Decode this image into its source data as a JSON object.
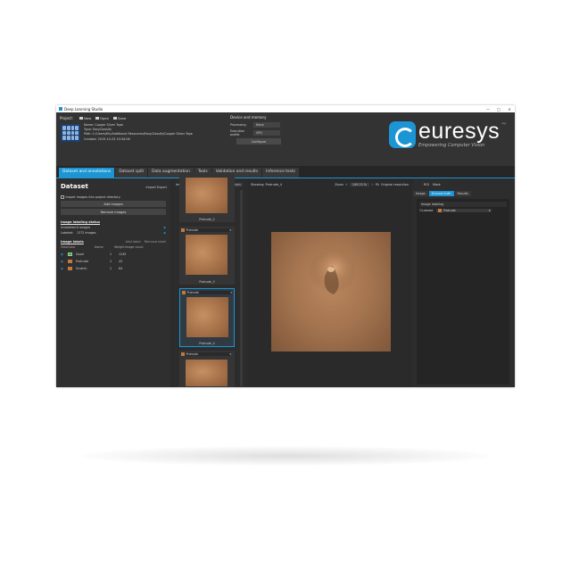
{
  "window": {
    "title": "Deep Learning Studio",
    "controls": [
      "—",
      "□",
      "✕"
    ]
  },
  "project": {
    "label": "Project:",
    "new_label": "New",
    "open_label": "Open",
    "save_label": "Save",
    "name": "Name: Copper Silver Tape",
    "type": "Type: EasyClassify",
    "path": "Path: C:/Users/Etc/Additional Resources/EasyClassify/Copper Silver Tape",
    "created": "Created: 2019-10-23 10:34:06"
  },
  "device": {
    "header": "Device and memory",
    "processing_label": "Processing",
    "processing_value": "None",
    "profile_label": "Execution profile",
    "profile_value": "GPU",
    "configure_label": "Configure"
  },
  "brand": {
    "name": "euresys",
    "tagline": "Empowering Computer Vision",
    "reg": "reg"
  },
  "tabs": [
    {
      "label": "Dataset and annotations"
    },
    {
      "label": "Dataset split"
    },
    {
      "label": "Data augmentation"
    },
    {
      "label": "Tools"
    },
    {
      "label": "Validation and results"
    },
    {
      "label": "Inference tests"
    }
  ],
  "dataset": {
    "title": "Dataset",
    "import_label": "Import",
    "export_label": "Export",
    "import_checkbox": "Import images into project directory",
    "add_images": "Add images",
    "remove_images": "Remove images",
    "labeling_header": "Image labeling status",
    "unlabeled_label": "Unlabeled:",
    "unlabeled_value": "0 images",
    "labeled_label": "Labeled:",
    "labeled_value": "1372 images",
    "labels_header": "Image labels",
    "add_label": "Add label",
    "remove_label": "Remove label",
    "col_view": "View",
    "col_color": "Color",
    "col_name": "Name",
    "col_weight": "Weight",
    "col_count": "Image count",
    "labels": [
      {
        "name": "Good",
        "weight": "1",
        "count": "1245",
        "color": "#3ea84a"
      },
      {
        "name": "Protrude",
        "weight": "1",
        "count": "43",
        "color": "#c07a3d"
      },
      {
        "name": "Scratch",
        "weight": "1",
        "count": "84",
        "color": "#c07a3d"
      }
    ]
  },
  "images": {
    "header": "Images",
    "filter_label": "Filter Protrudes",
    "cards": [
      {
        "caption": "Protrude_2",
        "label": ""
      },
      {
        "caption": "Protrude_3",
        "label": "Protrude"
      },
      {
        "caption": "Protrude_4",
        "label": "Protrude"
      },
      {
        "caption": "",
        "label": "Protrude"
      }
    ]
  },
  "viewer": {
    "header": "Showing: Protrude_4",
    "zoom_label": "Zoom",
    "zoom_value": "109.23 %",
    "fit_label": "Fit",
    "original_label": "Original resolution"
  },
  "right": {
    "roi_label": "ROI",
    "mask_label": "Mask",
    "tabs": [
      "Image",
      "Ground truth",
      "Results"
    ],
    "image_labeling": "Image labeling",
    "labeled_check": "Labeled",
    "label_value": "Protrude"
  }
}
